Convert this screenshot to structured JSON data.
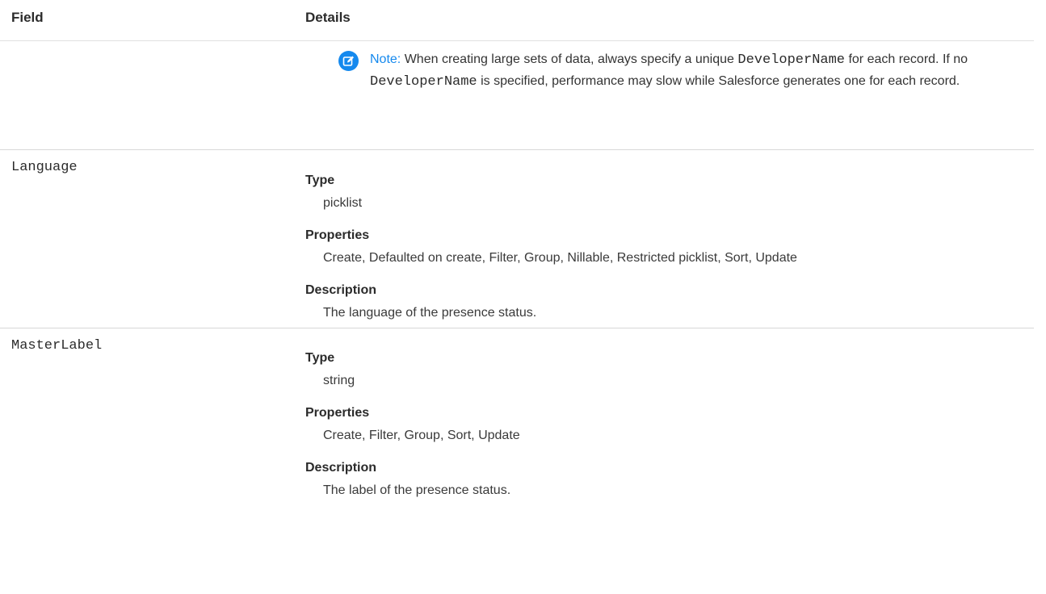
{
  "table": {
    "headers": {
      "field": "Field",
      "details": "Details"
    },
    "note": {
      "label": "Note:",
      "text_1": " When creating large sets of data, always specify a unique ",
      "code_1": "DeveloperName",
      "text_2": " for each record. If no ",
      "code_2": "DeveloperName",
      "text_3": " is specified, performance may slow while Salesforce generates one for each record."
    },
    "rows": [
      {
        "field": "Language",
        "type_label": "Type",
        "type_value": "picklist",
        "properties_label": "Properties",
        "properties_value": "Create, Defaulted on create, Filter, Group, Nillable, Restricted picklist, Sort, Update",
        "description_label": "Description",
        "description_value": "The language of the presence status."
      },
      {
        "field": "MasterLabel",
        "type_label": "Type",
        "type_value": "string",
        "properties_label": "Properties",
        "properties_value": "Create, Filter, Group, Sort, Update",
        "description_label": "Description",
        "description_value": "The label of the presence status."
      }
    ]
  },
  "icons": {
    "note": "edit-note-icon"
  },
  "colors": {
    "note_accent": "#1589ee"
  }
}
